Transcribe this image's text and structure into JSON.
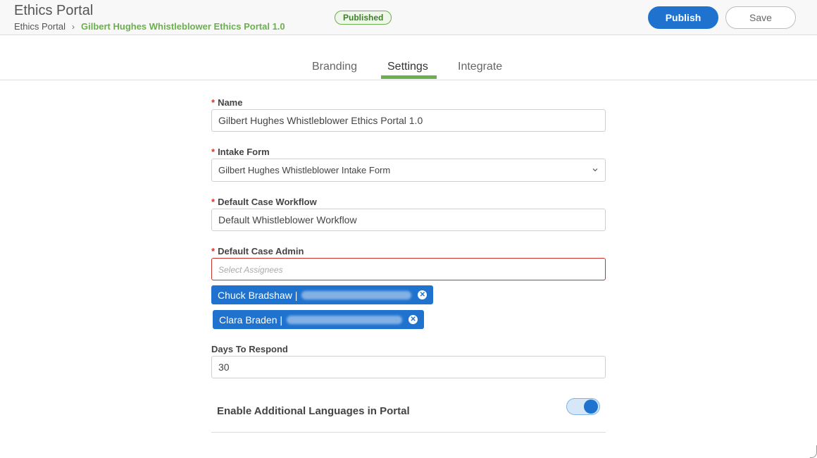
{
  "header": {
    "app_title": "Ethics Portal",
    "breadcrumb": {
      "root": "Ethics Portal",
      "current": "Gilbert Hughes Whistleblower Ethics Portal 1.0"
    },
    "status": "Published",
    "publish_label": "Publish",
    "save_label": "Save"
  },
  "tabs": [
    {
      "label": "Branding"
    },
    {
      "label": "Settings",
      "active": true
    },
    {
      "label": "Integrate"
    }
  ],
  "form": {
    "name": {
      "label": "Name",
      "value": "Gilbert Hughes Whistleblower Ethics Portal 1.0"
    },
    "intake_form": {
      "label": "Intake Form",
      "value": "Gilbert Hughes Whistleblower Intake Form"
    },
    "workflow": {
      "label": "Default Case Workflow",
      "value": "Default Whistleblower Workflow"
    },
    "case_admin": {
      "label": "Default Case Admin",
      "placeholder": "Select Assignees",
      "assignees": [
        {
          "name": "Chuck Bradshaw |"
        },
        {
          "name": "Clara Braden |"
        }
      ]
    },
    "days": {
      "label": "Days To Respond",
      "value": "30"
    },
    "languages": {
      "label": "Enable Additional Languages in Portal",
      "enabled": true
    }
  },
  "colors": {
    "primary": "#1f73cf",
    "accent_green": "#6ab04c",
    "error": "#c9302c"
  }
}
